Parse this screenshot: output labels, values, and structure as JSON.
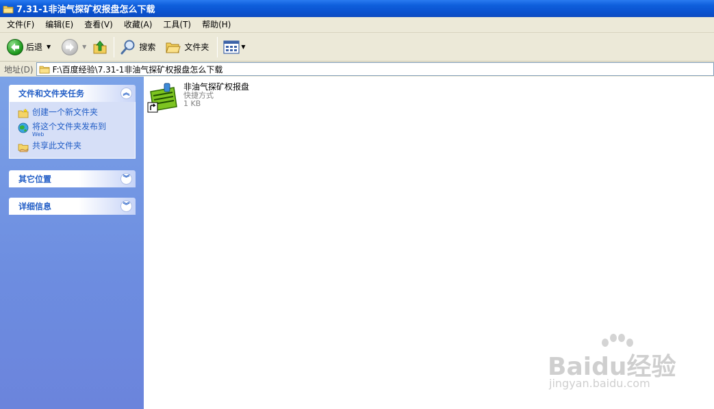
{
  "window": {
    "title": "7.31-1非油气探矿权报盘怎么下载"
  },
  "menu": [
    "文件(F)",
    "编辑(E)",
    "查看(V)",
    "收藏(A)",
    "工具(T)",
    "帮助(H)"
  ],
  "toolbar": {
    "back": "后退",
    "search": "搜索",
    "folders": "文件夹"
  },
  "address": {
    "label": "地址(D)",
    "path": "F:\\百度经验\\7.31-1非油气探矿权报盘怎么下载"
  },
  "tasks_panel": {
    "title": "文件和文件夹任务",
    "items": [
      {
        "label": "创建一个新文件夹",
        "sub": ""
      },
      {
        "label": "将这个文件夹发布到",
        "sub": "Web"
      },
      {
        "label": "共享此文件夹",
        "sub": ""
      }
    ]
  },
  "other_places": {
    "title": "其它位置"
  },
  "details": {
    "title": "详细信息"
  },
  "file": {
    "name": "非油气探矿权报盘",
    "type": "快捷方式",
    "size": "1 KB"
  },
  "watermark": {
    "brand": "Baidu经验",
    "url": "jingyan.baidu.com"
  },
  "colors": {
    "titlebar": "#0a52cf",
    "link": "#215dc6",
    "leftpane": "#7ba2e7"
  }
}
